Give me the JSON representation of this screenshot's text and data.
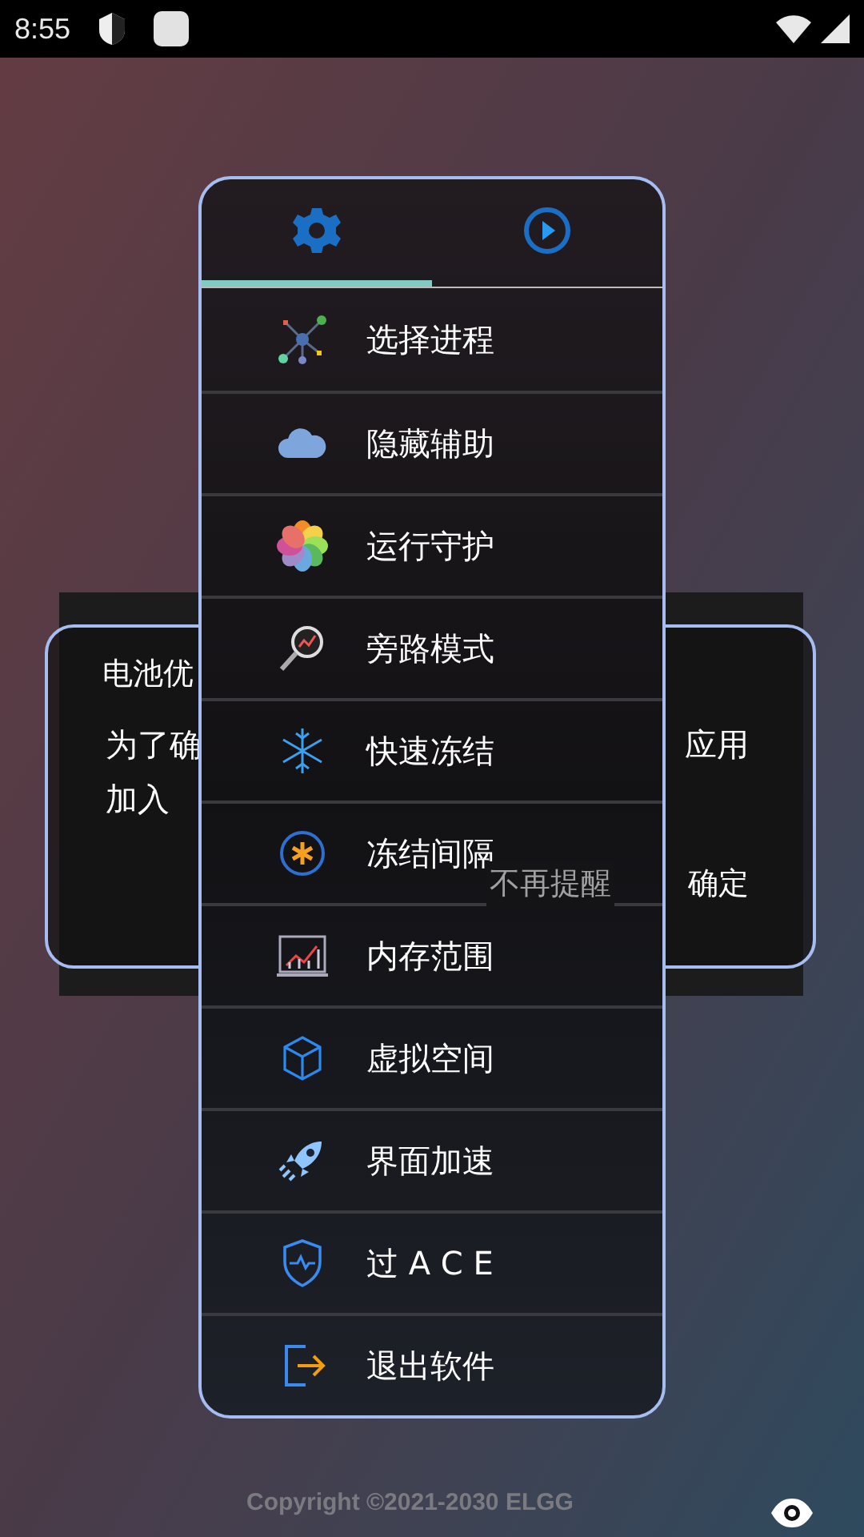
{
  "status_bar": {
    "time": "8:55"
  },
  "battery_dialog": {
    "title": "电池优",
    "message_lines": [
      [
        "为了确",
        "应用"
      ],
      [
        "加入"
      ]
    ],
    "buttons": [
      {
        "label": "不再提醒",
        "kind": "secondary"
      },
      {
        "label": "确定",
        "kind": "primary"
      }
    ]
  },
  "menu": {
    "tabs": [
      {
        "kind": "settings",
        "selected": true
      },
      {
        "kind": "play",
        "selected": false
      }
    ],
    "items": [
      {
        "label": "选择进程",
        "kind": "nodes"
      },
      {
        "label": "隐藏辅助",
        "kind": "cloud"
      },
      {
        "label": "运行守护",
        "kind": "flower"
      },
      {
        "label": "旁路模式",
        "kind": "magnifier"
      },
      {
        "label": "快速冻结",
        "kind": "snowflake"
      },
      {
        "label": "冻结间隔",
        "kind": "snow-badge"
      },
      {
        "label": "内存范围",
        "kind": "chart"
      },
      {
        "label": "虚拟空间",
        "kind": "cube"
      },
      {
        "label": "界面加速",
        "kind": "rocket"
      },
      {
        "label": "过 A C E",
        "kind": "shield"
      },
      {
        "label": "退出软件",
        "kind": "exit"
      }
    ]
  },
  "footer": {
    "copyright": "Copyright ©2021-2030 ELGG"
  }
}
